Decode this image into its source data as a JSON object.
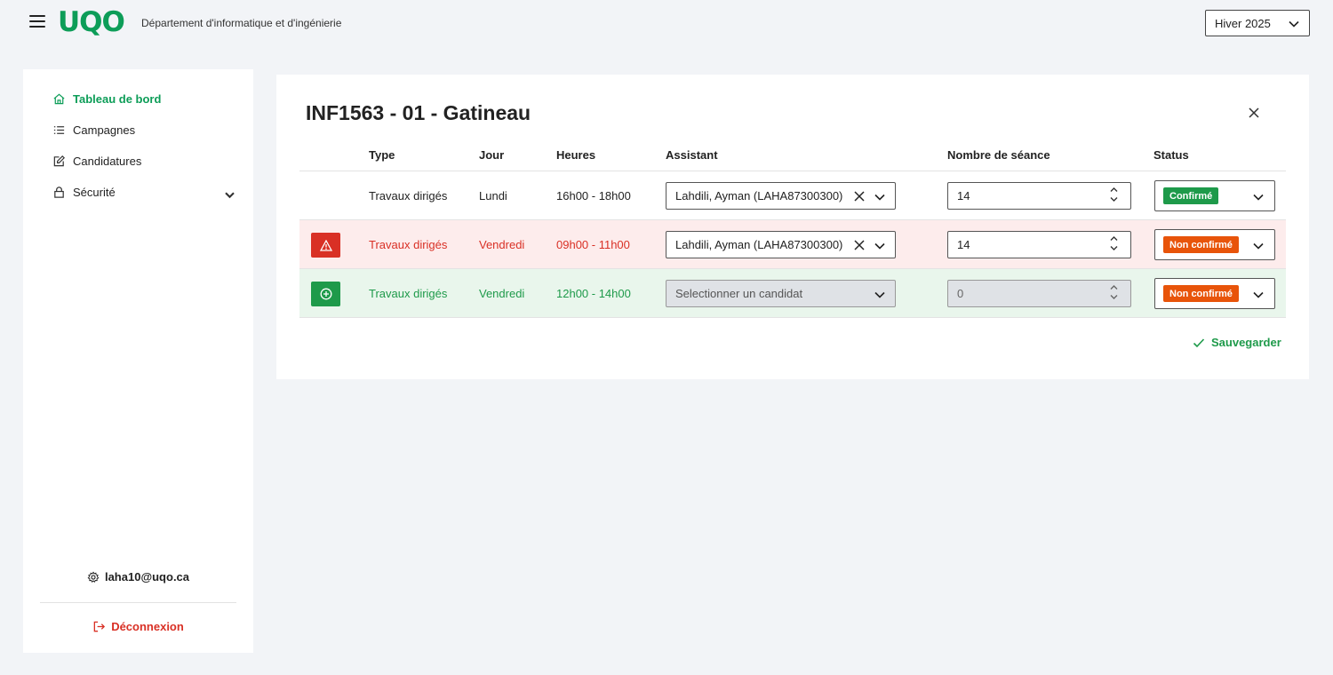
{
  "header": {
    "logo": "UQO",
    "department": "Département d'informatique et d'ingénierie",
    "term_select": "Hiver 2025"
  },
  "sidebar": {
    "items": [
      {
        "label": "Tableau de bord",
        "icon": "home-icon",
        "active": true
      },
      {
        "label": "Campagnes",
        "icon": "list-icon"
      },
      {
        "label": "Candidatures",
        "icon": "edit-icon"
      },
      {
        "label": "Sécurité",
        "icon": "lock-icon",
        "expandable": true
      }
    ],
    "user_email": "laha10@uqo.ca",
    "logout_label": "Déconnexion"
  },
  "panel": {
    "title": "INF1563 - 01 - Gatineau",
    "columns": [
      "Type",
      "Jour",
      "Heures",
      "Assistant",
      "Nombre de séance",
      "Status"
    ],
    "rows": [
      {
        "state": "normal",
        "type": "Travaux dirigés",
        "jour": "Lundi",
        "heures": "16h00 - 18h00",
        "assistant": "Lahdili, Ayman (LAHA87300300)",
        "seances": "14",
        "status": "Confirmé"
      },
      {
        "state": "warning",
        "icon": "warning-icon",
        "type": "Travaux dirigés",
        "jour": "Vendredi",
        "heures": "09h00 - 11h00",
        "assistant": "Lahdili, Ayman (LAHA87300300)",
        "seances": "14",
        "status": "Non confirmé"
      },
      {
        "state": "new",
        "icon": "add-circle-icon",
        "type": "Travaux dirigés",
        "jour": "Vendredi",
        "heures": "12h00 - 14h00",
        "assistant_placeholder": "Selectionner un candidat",
        "seances": "0",
        "status": "Non confirmé"
      }
    ],
    "save_label": "Sauvegarder"
  },
  "colors": {
    "brand_green": "#0d9d58",
    "success_green": "#1e9a4a",
    "error_red": "#d93025",
    "warning_orange": "#e8540a"
  }
}
